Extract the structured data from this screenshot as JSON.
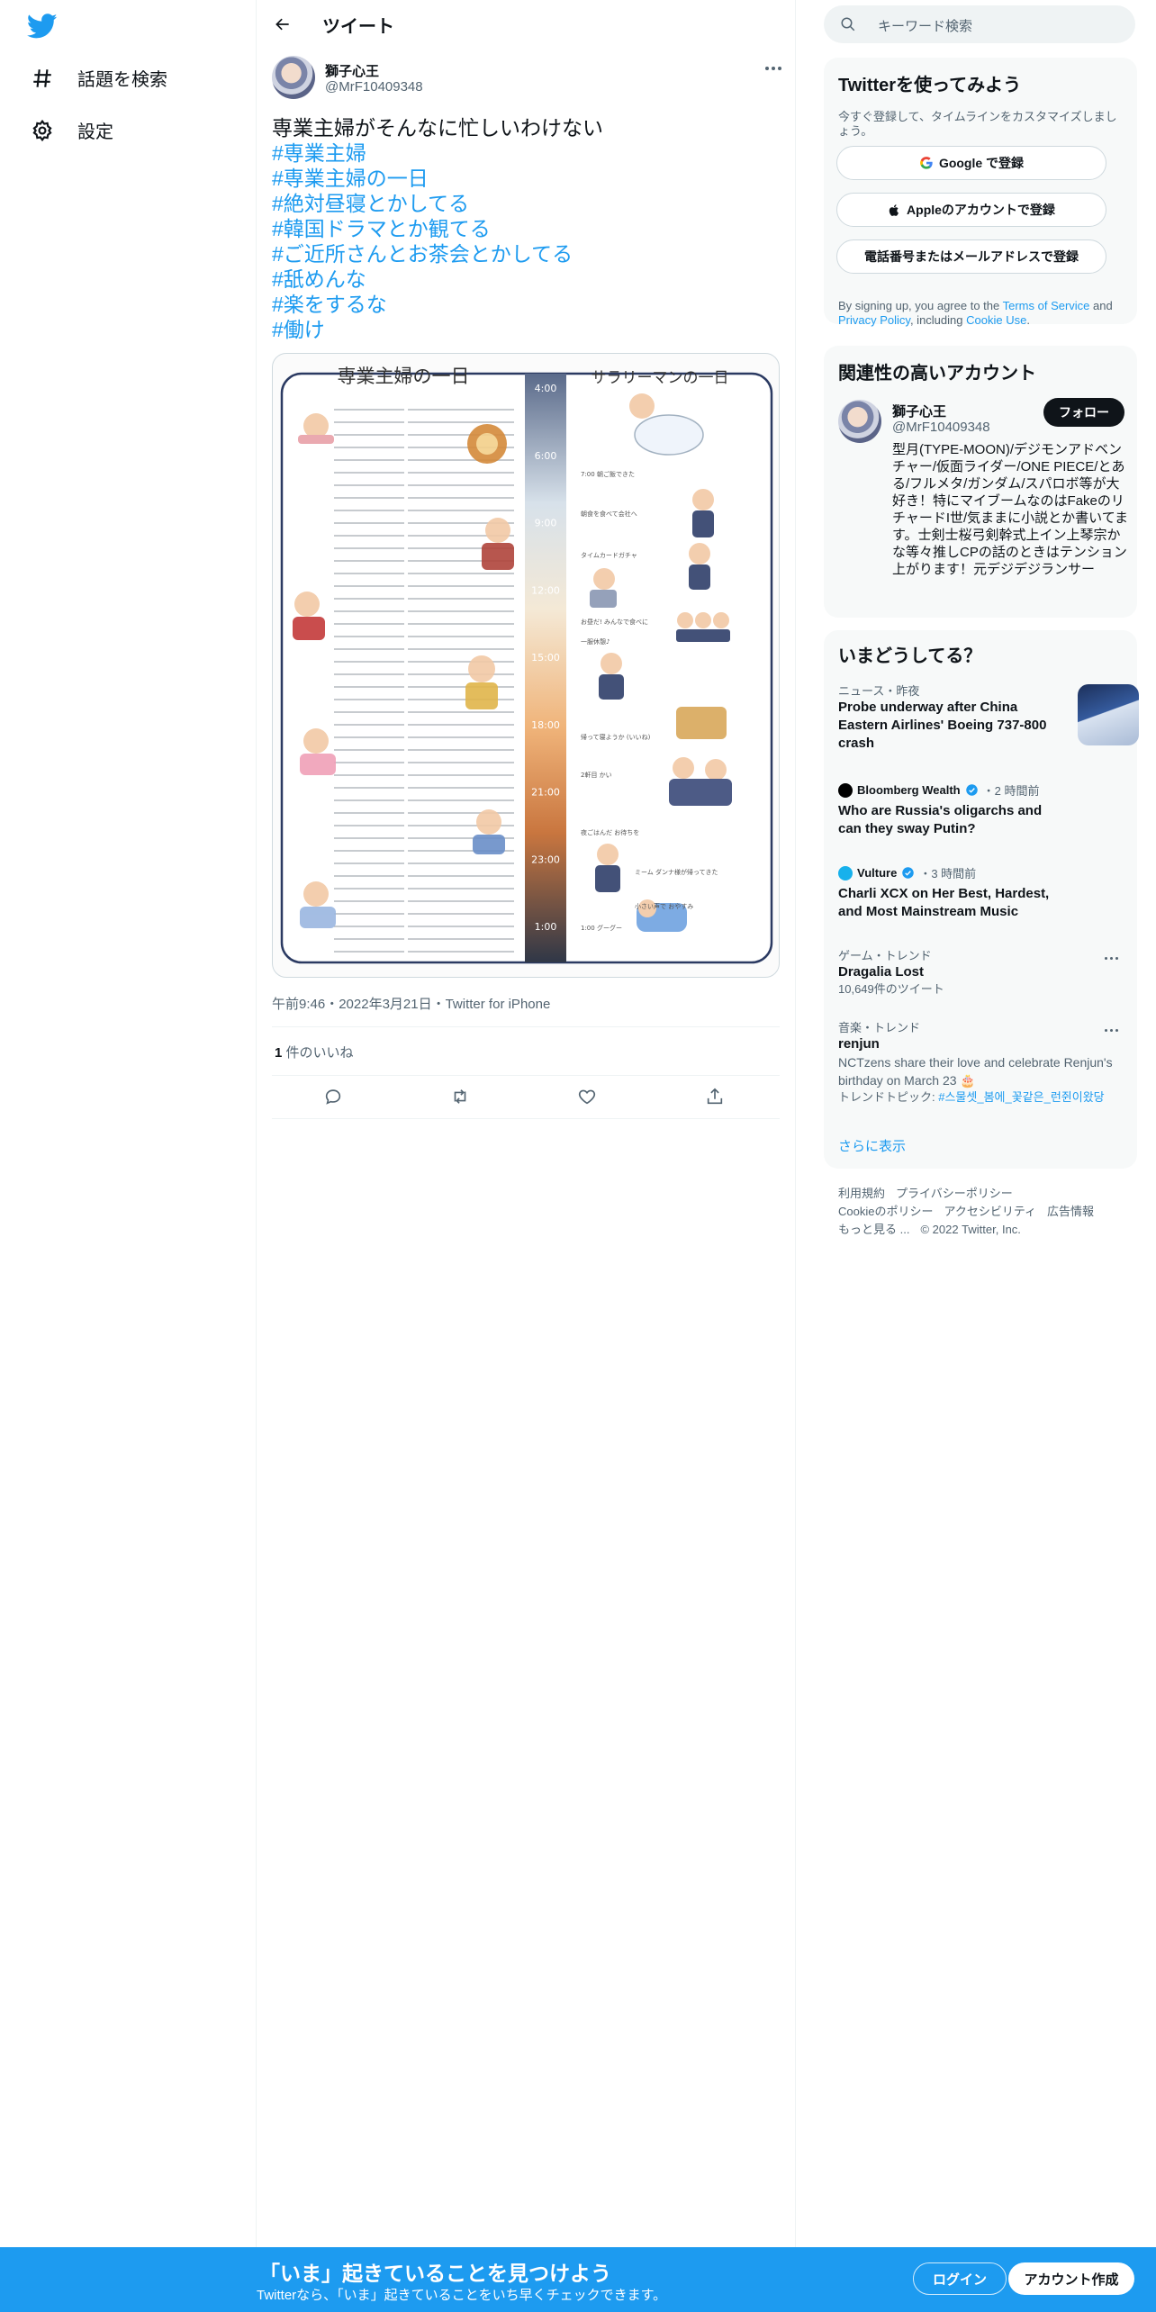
{
  "nav": {
    "explore_label": "話題を検索",
    "settings_label": "設定"
  },
  "header": {
    "title": "ツイート"
  },
  "tweet": {
    "author_name": "獅子心王",
    "author_handle": "@MrF10409348",
    "text_line": "専業主婦がそんなに忙しいわけない",
    "hashtags": [
      "#専業主婦",
      "#専業主婦の一日",
      "#絶対昼寝とかしてる",
      "#韓国ドラマとか観てる",
      "#ご近所さんとお茶会とかしてる",
      "#舐めんな",
      "#楽をするな",
      "#働け"
    ],
    "meta": "午前9:46・2022年3月21日・Twitter for iPhone",
    "likes_count": "1",
    "likes_label": " 件のいいね"
  },
  "media": {
    "left_title": "専業主婦の一日",
    "right_title": "サラリーマンの一日",
    "times": [
      "4:00",
      "6:00",
      "9:00",
      "12:00",
      "15:00",
      "18:00",
      "21:00",
      "23:00",
      "1:00"
    ],
    "right_notes": [
      "7:00 朝ご飯できた",
      "朝食を食べて会社へ",
      "タイムカードガチャ",
      "お昼だ! みんなで食べに",
      "一服休憩♪",
      "帰って寝ようか (いいね)",
      "2軒目 かい",
      "夜ごはんだ お待ちを",
      "ミーム ダンナ様が帰ってきた",
      "小さい声で おやすみ",
      "1:00 グーグー"
    ]
  },
  "search": {
    "placeholder": "キーワード検索"
  },
  "signup": {
    "title": "Twitterを使ってみよう",
    "subtitle": "今すぐ登録して、タイムラインをカスタマイズしましょう。",
    "google": "Google で登録",
    "apple": "Appleのアカウントで登録",
    "phone": "電話番号またはメールアドレスで登録",
    "legal_prefix": "By signing up, you agree to the ",
    "terms": "Terms of Service",
    "and": " and ",
    "privacy": "Privacy Policy",
    "including": ", including ",
    "cookie": "Cookie Use",
    "period": "."
  },
  "related": {
    "title": "関連性の高いアカウント",
    "name": "獅子心王",
    "handle": "@MrF10409348",
    "follow": "フォロー",
    "bio": "型月(TYPE-MOON)/デジモンアドベンチャー/仮面ライダー/ONE PIECE/とある/フルメタ/ガンダム/スパロボ等が大好き！特にマイブームなのはFakeのリチャードI世/気ままに小説とか書いてます。士剣士桜弓剣幹式上イン上琴宗かな等々推しCPの話のときはテンション上がります！元デジデジランサー"
  },
  "trends": {
    "title": "いまどうしてる？",
    "items": [
      {
        "context": "ニュース・昨夜",
        "title": "Probe underway after China Eastern Airlines' Boeing 737-800 crash"
      },
      {
        "source": "Bloomberg Wealth",
        "time": "・2 時間前",
        "title": "Who are Russia's oligarchs and can they sway Putin?"
      },
      {
        "source": "Vulture",
        "time": "・3 時間前",
        "title": "Charli XCX on Her Best, Hardest, and Most Mainstream Music"
      },
      {
        "context": "ゲーム・トレンド",
        "title": "Dragalia Lost",
        "sub": "10,649件のツイート"
      },
      {
        "context": "音楽・トレンド",
        "title": "renjun",
        "desc": "NCTzens share their love and celebrate Renjun's birthday on March 23 🎂",
        "topic_prefix": "トレンドトピック: ",
        "topic": "#스물셋_봄에_꽃같은_런쥔이왔당"
      }
    ],
    "show_more": "さらに表示"
  },
  "footer": {
    "links": [
      "利用規約",
      "プライバシーポリシー",
      "Cookieのポリシー",
      "アクセシビリティ",
      "広告情報",
      "もっと見る ..."
    ],
    "copyright": "© 2022 Twitter, Inc."
  },
  "bottom": {
    "title": "「いま」起きていることを見つけよう",
    "subtitle": "Twitterなら、「いま」起きていることをいち早くチェックできます。",
    "login": "ログイン",
    "signup": "アカウント作成"
  },
  "colors": {
    "accent": "#1d9bf0",
    "text": "#0f1419",
    "muted": "#536471",
    "card": "#f7f9f9"
  }
}
